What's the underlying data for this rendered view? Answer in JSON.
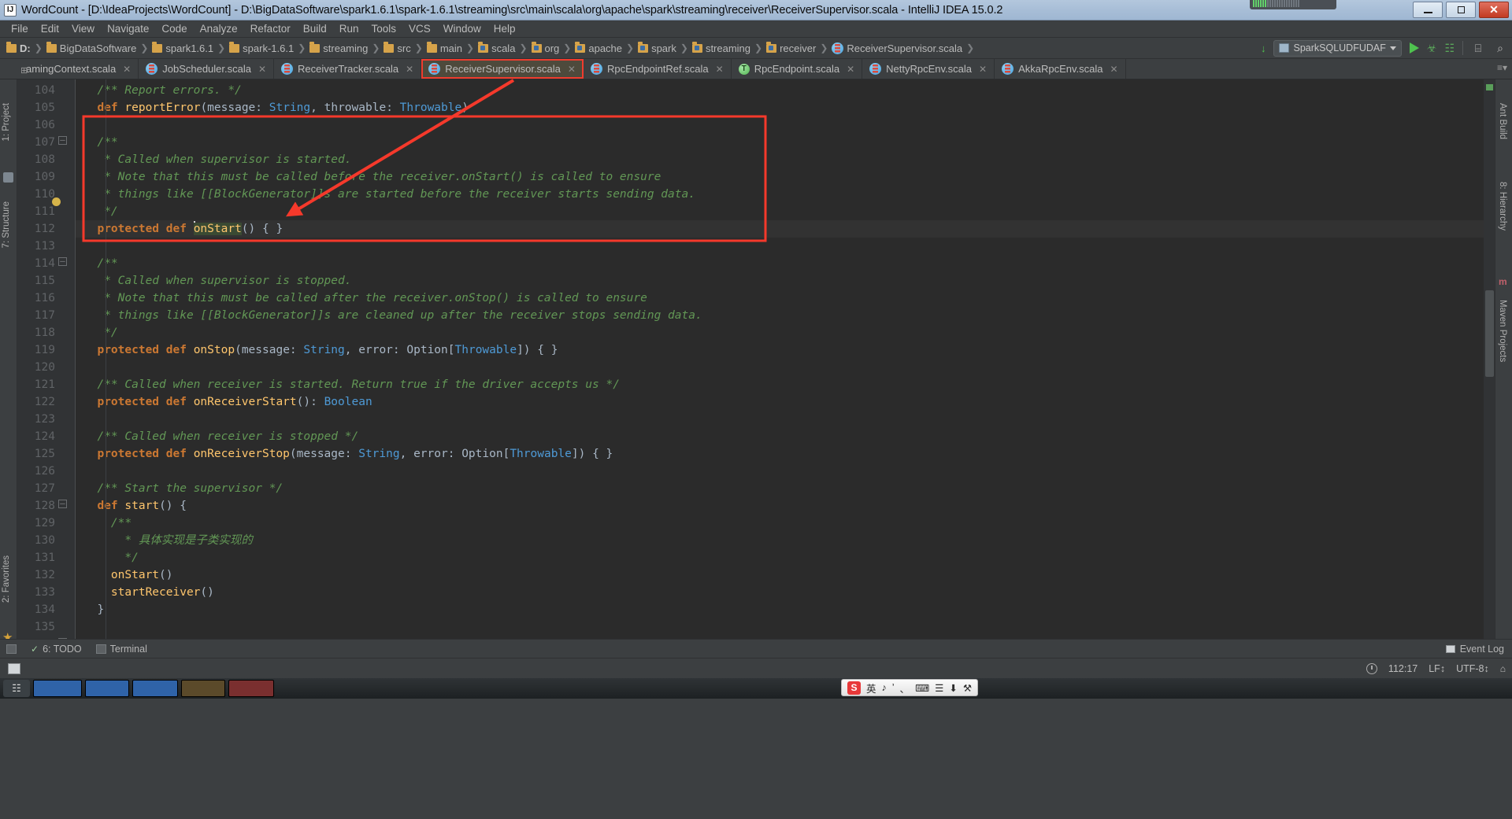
{
  "window": {
    "title": "WordCount - [D:\\IdeaProjects\\WordCount] - D:\\BigDataSoftware\\spark1.6.1\\spark-1.6.1\\streaming\\src\\main\\scala\\org\\apache\\spark\\streaming\\receiver\\ReceiverSupervisor.scala - IntelliJ IDEA 15.0.2",
    "app_icon": "IJ",
    "minimize": "–",
    "maximize": "□",
    "close": "✕"
  },
  "menubar": {
    "items": [
      "File",
      "Edit",
      "View",
      "Navigate",
      "Code",
      "Analyze",
      "Refactor",
      "Build",
      "Run",
      "Tools",
      "VCS",
      "Window",
      "Help"
    ]
  },
  "navbar": {
    "crumbs": [
      {
        "label": "D:",
        "icon": "folder-icon",
        "bold": true
      },
      {
        "label": "BigDataSoftware",
        "icon": "folder-icon",
        "bold": false
      },
      {
        "label": "spark1.6.1",
        "icon": "folder-icon",
        "bold": false
      },
      {
        "label": "spark-1.6.1",
        "icon": "folder-icon",
        "bold": false
      },
      {
        "label": "streaming",
        "icon": "folder-icon",
        "bold": false
      },
      {
        "label": "src",
        "icon": "folder-icon",
        "bold": false
      },
      {
        "label": "main",
        "icon": "folder-icon",
        "bold": false
      },
      {
        "label": "scala",
        "icon": "source-folder-icon",
        "bold": false
      },
      {
        "label": "org",
        "icon": "source-folder-icon",
        "bold": false
      },
      {
        "label": "apache",
        "icon": "source-folder-icon",
        "bold": false
      },
      {
        "label": "spark",
        "icon": "source-folder-icon",
        "bold": false
      },
      {
        "label": "streaming",
        "icon": "source-folder-icon",
        "bold": false
      },
      {
        "label": "receiver",
        "icon": "source-folder-icon",
        "bold": false
      },
      {
        "label": "ReceiverSupervisor.scala",
        "icon": "scala-file-icon",
        "bold": false
      }
    ],
    "separator": "❯",
    "run_config": "SparkSQLUDFUDAF",
    "update_icon": "↓",
    "run_icon": "run-icon",
    "debug_icon": "debug-icon",
    "coverage_icon": "coverage-icon",
    "layout_icon": "⌸",
    "search_icon": "⌕"
  },
  "tabs": [
    {
      "label": "amingContext.scala",
      "icon": "scala-file-icon",
      "active": false,
      "marked": false,
      "pinned": true
    },
    {
      "label": "JobScheduler.scala",
      "icon": "scala-file-icon",
      "active": false,
      "marked": false
    },
    {
      "label": "ReceiverTracker.scala",
      "icon": "scala-file-icon",
      "active": false,
      "marked": false
    },
    {
      "label": "ReceiverSupervisor.scala",
      "icon": "scala-file-icon",
      "active": true,
      "marked": true
    },
    {
      "label": "RpcEndpointRef.scala",
      "icon": "scala-file-icon",
      "active": false,
      "marked": false
    },
    {
      "label": "RpcEndpoint.scala",
      "icon": "trait-icon",
      "active": false,
      "marked": false
    },
    {
      "label": "NettyRpcEnv.scala",
      "icon": "scala-file-icon",
      "active": false,
      "marked": false
    },
    {
      "label": "AkkaRpcEnv.scala",
      "icon": "scala-file-icon",
      "active": false,
      "marked": false
    }
  ],
  "tab_close_glyph": "✕",
  "left_rail": {
    "items": [
      "1: Project",
      "7: Structure",
      "2: Favorites"
    ]
  },
  "right_rail": {
    "items": [
      "Ant Build",
      "8: Hierarchy",
      "Maven Projects"
    ]
  },
  "editor": {
    "first_line": 104,
    "lines": [
      {
        "n": 104,
        "text": "  /** Report errors. */"
      },
      {
        "n": 105,
        "text": "  def reportError(message: String, throwable: Throwable)"
      },
      {
        "n": 106,
        "text": ""
      },
      {
        "n": 107,
        "text": "  /**"
      },
      {
        "n": 108,
        "text": "   * Called when supervisor is started."
      },
      {
        "n": 109,
        "text": "   * Note that this must be called before the receiver.onStart() is called to ensure"
      },
      {
        "n": 110,
        "text": "   * things like [[BlockGenerator]]s are started before the receiver starts sending data."
      },
      {
        "n": 111,
        "text": "   */"
      },
      {
        "n": 112,
        "text": "  protected def onStart() { }"
      },
      {
        "n": 113,
        "text": ""
      },
      {
        "n": 114,
        "text": "  /**"
      },
      {
        "n": 115,
        "text": "   * Called when supervisor is stopped."
      },
      {
        "n": 116,
        "text": "   * Note that this must be called after the receiver.onStop() is called to ensure"
      },
      {
        "n": 117,
        "text": "   * things like [[BlockGenerator]]s are cleaned up after the receiver stops sending data."
      },
      {
        "n": 118,
        "text": "   */"
      },
      {
        "n": 119,
        "text": "  protected def onStop(message: String, error: Option[Throwable]) { }"
      },
      {
        "n": 120,
        "text": ""
      },
      {
        "n": 121,
        "text": "  /** Called when receiver is started. Return true if the driver accepts us */"
      },
      {
        "n": 122,
        "text": "  protected def onReceiverStart(): Boolean"
      },
      {
        "n": 123,
        "text": ""
      },
      {
        "n": 124,
        "text": "  /** Called when receiver is stopped */"
      },
      {
        "n": 125,
        "text": "  protected def onReceiverStop(message: String, error: Option[Throwable]) { }"
      },
      {
        "n": 126,
        "text": ""
      },
      {
        "n": 127,
        "text": "  /** Start the supervisor */"
      },
      {
        "n": 128,
        "text": "  def start() {"
      },
      {
        "n": 129,
        "text": "    /**"
      },
      {
        "n": 130,
        "text": "      * 具体实现是子类实现的"
      },
      {
        "n": 131,
        "text": "      */"
      },
      {
        "n": 132,
        "text": "    onStart()"
      },
      {
        "n": 133,
        "text": "    startReceiver()"
      },
      {
        "n": 134,
        "text": "  }"
      },
      {
        "n": 135,
        "text": ""
      }
    ],
    "selected_token": "onStart",
    "chinese_comment": "具体实现是子类实现的"
  },
  "annotations": {
    "tab_highlight": "ReceiverSupervisor.scala",
    "code_highlight_block": "onStart declaration block lines 107-112",
    "arrow": "arrow from tab to onStart method",
    "color": "#f03c2e"
  },
  "bottombar": {
    "todo_label": "6: TODO",
    "terminal_label": "Terminal",
    "event_log_label": "Event Log"
  },
  "statusbar": {
    "caret_position": "112:17",
    "line_separator": "LF↕",
    "encoding": "UTF-8↕",
    "lock_icon": "⌂",
    "clock_icon": "clock-icon"
  },
  "taskbar": {
    "ime": {
      "logo": "S",
      "lang": "英",
      "glyphs": [
        "♪",
        "’",
        "、",
        "⌨",
        "☰",
        "⬇",
        "⚒"
      ]
    }
  }
}
